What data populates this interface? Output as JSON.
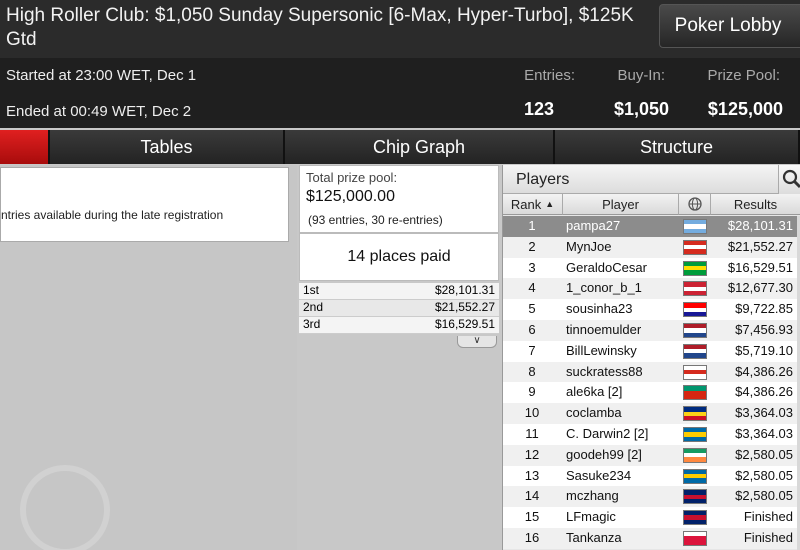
{
  "header": {
    "title": "High Roller Club: $1,050 Sunday Supersonic [6-Max, Hyper-Turbo], $125K Gtd",
    "lobby_button": "Poker Lobby",
    "started": "Started at 23:00 WET, Dec 1",
    "ended": "Ended at 00:49 WET, Dec 2",
    "stats": [
      {
        "label": "Entries:",
        "value": "123"
      },
      {
        "label": "Buy-In:",
        "value": "$1,050"
      },
      {
        "label": "Prize Pool:",
        "value": "$125,000"
      }
    ]
  },
  "tabs": [
    {
      "label": ""
    },
    {
      "label": "Tables"
    },
    {
      "label": "Chip Graph"
    },
    {
      "label": "Structure"
    }
  ],
  "left_panel": {
    "info_text": "ntries available during the late registration"
  },
  "prize_panel": {
    "total_label": "Total prize pool:",
    "total_value": "$125,000.00",
    "entries_note": "(93 entries, 30 re-entries)",
    "places_paid": "14 places paid",
    "payouts": [
      {
        "place": "1st",
        "amount": "$28,101.31"
      },
      {
        "place": "2nd",
        "amount": "$21,552.27"
      },
      {
        "place": "3rd",
        "amount": "$16,529.51"
      }
    ]
  },
  "players_panel": {
    "title": "Players",
    "columns": {
      "rank": "Rank",
      "player": "Player",
      "results": "Results"
    },
    "rows": [
      {
        "rank": "1",
        "player": "pampa27",
        "flag": [
          "#74acdf",
          "#ffffff",
          "#74acdf"
        ],
        "result": "$28,101.31",
        "selected": true
      },
      {
        "rank": "2",
        "player": "MynJoe",
        "flag": [
          "#d52b1e",
          "#ffffff",
          "#d52b1e"
        ],
        "result": "$21,552.27"
      },
      {
        "rank": "3",
        "player": "GeraldoCesar",
        "flag": [
          "#009c3b",
          "#ffdf00",
          "#009c3b"
        ],
        "result": "$16,529.51"
      },
      {
        "rank": "4",
        "player": "1_conor_b_1",
        "flag": [
          "#cc2233",
          "#ffffff",
          "#cc2233"
        ],
        "result": "$12,677.30"
      },
      {
        "rank": "5",
        "player": "sousinha23",
        "flag": [
          "#ff0000",
          "#ffffff",
          "#171796"
        ],
        "result": "$9,722.85"
      },
      {
        "rank": "6",
        "player": "tinnoemulder",
        "flag": [
          "#ae1c28",
          "#ffffff",
          "#21468b"
        ],
        "result": "$7,456.93"
      },
      {
        "rank": "7",
        "player": "BillLewinsky",
        "flag": [
          "#ae1c28",
          "#ffffff",
          "#21468b"
        ],
        "result": "$5,719.10"
      },
      {
        "rank": "8",
        "player": "suckratess88",
        "flag": [
          "#ffffff",
          "#d52b1e",
          "#ffffff"
        ],
        "result": "$4,386.26"
      },
      {
        "rank": "9",
        "player": "ale6ka [2]",
        "flag": [
          "#00966e",
          "#d62612",
          "#d62612"
        ],
        "result": "$4,386.26"
      },
      {
        "rank": "10",
        "player": "coclamba",
        "flag": [
          "#002b7f",
          "#fcd116",
          "#ce1126"
        ],
        "result": "$3,364.03"
      },
      {
        "rank": "11",
        "player": "C. Darwin2 [2]",
        "flag": [
          "#006aa7",
          "#fecc00",
          "#006aa7"
        ],
        "result": "$3,364.03"
      },
      {
        "rank": "12",
        "player": "goodeh99 [2]",
        "flag": [
          "#169b62",
          "#ffffff",
          "#ff883e"
        ],
        "result": "$2,580.05"
      },
      {
        "rank": "13",
        "player": "Sasuke234",
        "flag": [
          "#006aa7",
          "#fecc00",
          "#006aa7"
        ],
        "result": "$2,580.05"
      },
      {
        "rank": "14",
        "player": "mczhang",
        "flag": [
          "#012169",
          "#c8102e",
          "#012169"
        ],
        "result": "$2,580.05"
      },
      {
        "rank": "15",
        "player": "LFmagic",
        "flag": [
          "#012169",
          "#c8102e",
          "#012169"
        ],
        "result": "Finished"
      },
      {
        "rank": "16",
        "player": "Tankanza",
        "flag": [
          "#ffffff",
          "#dc143c",
          "#dc143c"
        ],
        "result": "Finished"
      }
    ]
  }
}
